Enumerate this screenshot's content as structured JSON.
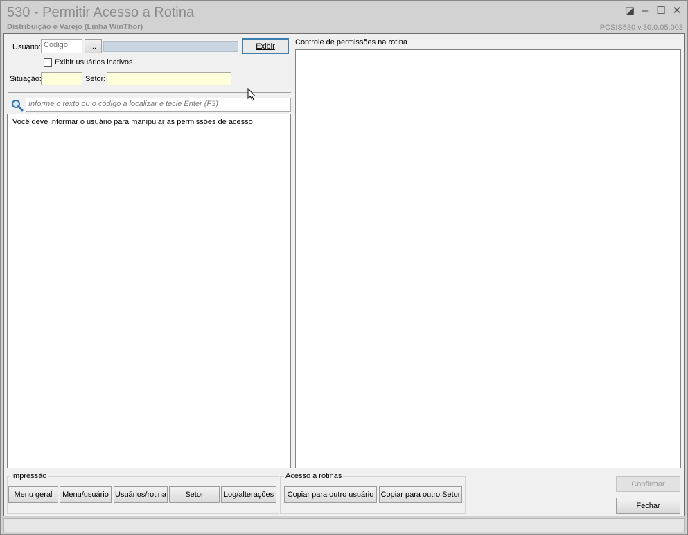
{
  "window": {
    "title": "530 - Permitir Acesso a Rotina",
    "subtitle": "Distribuição e Varejo (Linha WinThor)",
    "version": "PCSIS530  v.30.0.05.003",
    "controls": {
      "restore": "◪",
      "minimize": "–",
      "maximize": "☐",
      "close": "✕"
    }
  },
  "filters": {
    "usuario_label": "Usuário:",
    "codigo_placeholder": "Código",
    "lookup_button": "...",
    "exibir_button": "Exibir",
    "inativos_label": "Exibir usuários inativos",
    "situacao_label": "Situação:",
    "setor_label": "Setor:"
  },
  "search": {
    "icon": "magnifier-icon",
    "placeholder": "Informe o texto ou o código a localizar e tecle Enter (F3)"
  },
  "left_panel": {
    "message": "Você deve informar o usuário para manipular as permissões de acesso"
  },
  "right_panel": {
    "title": "Controle de permissões na rotina"
  },
  "impressao": {
    "legend": "Impressão",
    "buttons": {
      "menu_geral": "Menu geral",
      "menu_usuario": "Menu/usuário",
      "usuarios_rotina": "Usuários/rotina",
      "setor": "Setor",
      "log_alteracoes": "Log/alterações"
    }
  },
  "acesso": {
    "legend": "Acesso a rotinas",
    "buttons": {
      "copiar_usuario": "Copiar para outro usuário",
      "copiar_setor": "Copiar para outro Setor"
    }
  },
  "actions": {
    "confirmar": "Confirmar",
    "fechar": "Fechar"
  }
}
